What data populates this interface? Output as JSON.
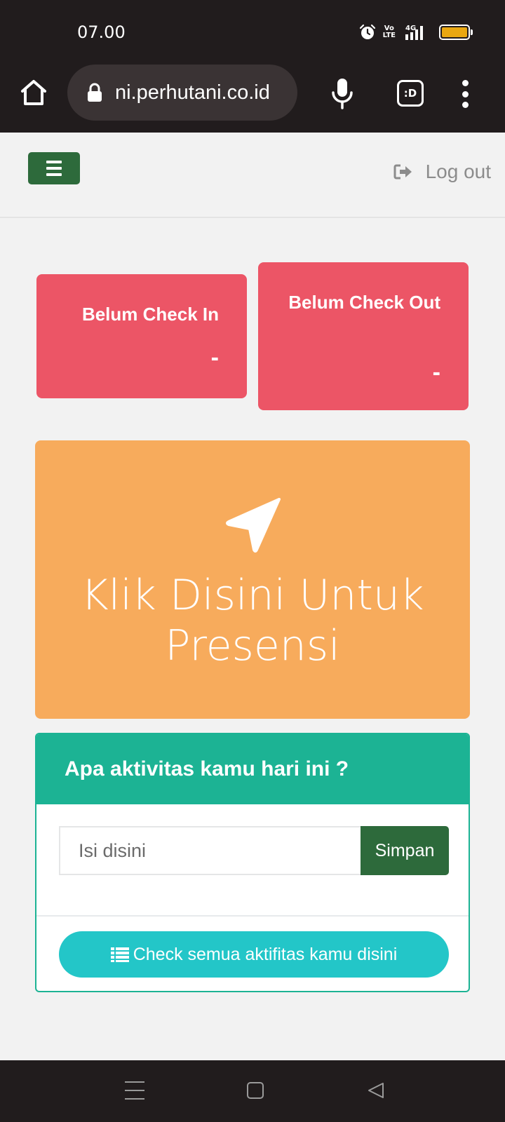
{
  "status_bar": {
    "time": "07.00",
    "network_top": "Vo",
    "network_bottom": "LTE",
    "network_type": "4G",
    "battery_color": "#e9a711",
    "icons": [
      "alarm-icon",
      "volte-icon",
      "signal-icon",
      "battery-icon"
    ]
  },
  "browser": {
    "url": "ni.perhutani.co.id",
    "tabs_label": ":D",
    "icons": [
      "home-icon",
      "lock-icon",
      "mic-icon",
      "tabs-icon",
      "more-icon"
    ]
  },
  "header": {
    "menu_icon": "menu-icon",
    "logout_label": "Log out",
    "logout_icon": "sign-out-icon",
    "menu_color": "#2d6a3b"
  },
  "cards": {
    "check_in": {
      "label": "Belum Check In",
      "value": "-"
    },
    "check_out": {
      "label": "Belum Check Out",
      "value": "-"
    },
    "color": "#ec5566"
  },
  "presensi": {
    "icon": "location-arrow-icon",
    "line1": "Klik Disini Untuk",
    "line2": "Presensi",
    "color": "#f7ab5c"
  },
  "activity": {
    "title": "Apa aktivitas kamu hari ini ?",
    "input_placeholder": "Isi disini",
    "input_value": "",
    "save_label": "Simpan",
    "view_all_label": "Check semua aktifitas kamu disini",
    "view_all_icon": "list-icon",
    "head_color": "#1cb394",
    "button_color": "#23c6c8"
  },
  "nav_bar": {
    "icons": [
      "recent-apps-icon",
      "home-nav-icon",
      "back-icon"
    ]
  }
}
